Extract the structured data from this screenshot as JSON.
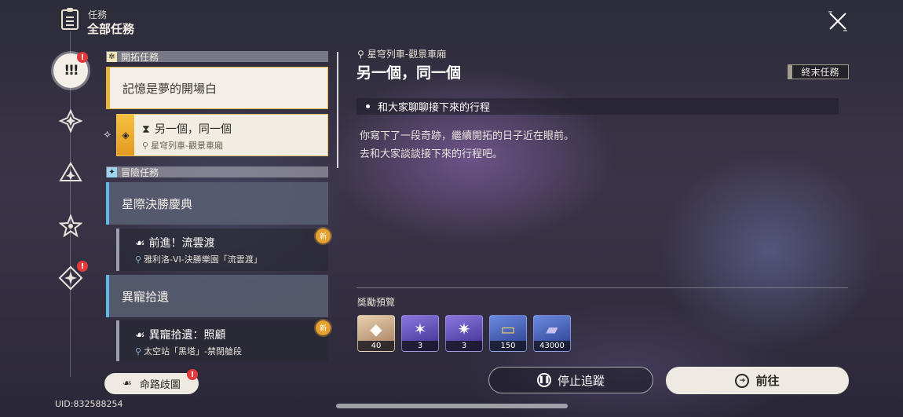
{
  "header": {
    "category": "任務",
    "title": "全部任務"
  },
  "rail": {
    "main_icon": "!!!",
    "badge": "!",
    "items": [
      {
        "icon": "trailblaze-star-icon",
        "badge": ""
      },
      {
        "icon": "triangle-star-icon",
        "badge": ""
      },
      {
        "icon": "five-point-star-icon",
        "badge": ""
      },
      {
        "icon": "diamond-star-icon",
        "badge": "!"
      }
    ]
  },
  "quest_list": {
    "sections": [
      {
        "name": "開拓任務",
        "chapters": [
          {
            "title": "記憶是夢的開場白",
            "quests": [
              {
                "title": "另一個，同一個",
                "location": "星穹列車-觀景車廂",
                "state": "active",
                "new": false
              }
            ]
          }
        ]
      },
      {
        "name": "冒險任務",
        "chapters": [
          {
            "title": "星際決勝慶典",
            "quests": [
              {
                "title": "前進！流雲渡",
                "location": "雅利洛-VI-決勝樂園「流雲渡」",
                "state": "normal",
                "new": true
              }
            ]
          },
          {
            "title": "異寵拾遺",
            "quests": [
              {
                "title": "異寵拾遺：照顧",
                "location": "太空站「黑塔」-禁閉艙段",
                "state": "normal",
                "new": true
              }
            ]
          }
        ]
      }
    ],
    "new_badge_label": "新"
  },
  "detail": {
    "location": "星穹列車-觀景車廂",
    "title": "另一個，同一個",
    "tag": "終末任務",
    "objective": "和大家聊聊接下來的行程",
    "description": [
      "你寫下了一段奇跡，繼續開拓的日子近在眼前。",
      "去和大家談談接下來的行程吧。"
    ],
    "reward_label": "獎勵預覽",
    "rewards": [
      {
        "icon": "stellar-jade-icon",
        "count": "40",
        "color": "#c9a47c"
      },
      {
        "icon": "purple-material-icon",
        "count": "3",
        "color": "#6a58c4"
      },
      {
        "icon": "purple-material-2-icon",
        "count": "3",
        "color": "#6a58c4"
      },
      {
        "icon": "credit-ticket-icon",
        "count": "150",
        "color": "#4a6ac0"
      },
      {
        "icon": "exp-material-icon",
        "count": "43000",
        "color": "#4a6ac0"
      }
    ]
  },
  "buttons": {
    "stop_tracking": "停止追蹤",
    "go": "前往",
    "map": "命路歧圖",
    "map_badge": "!"
  },
  "footer": {
    "uid": "UID:832588254"
  }
}
